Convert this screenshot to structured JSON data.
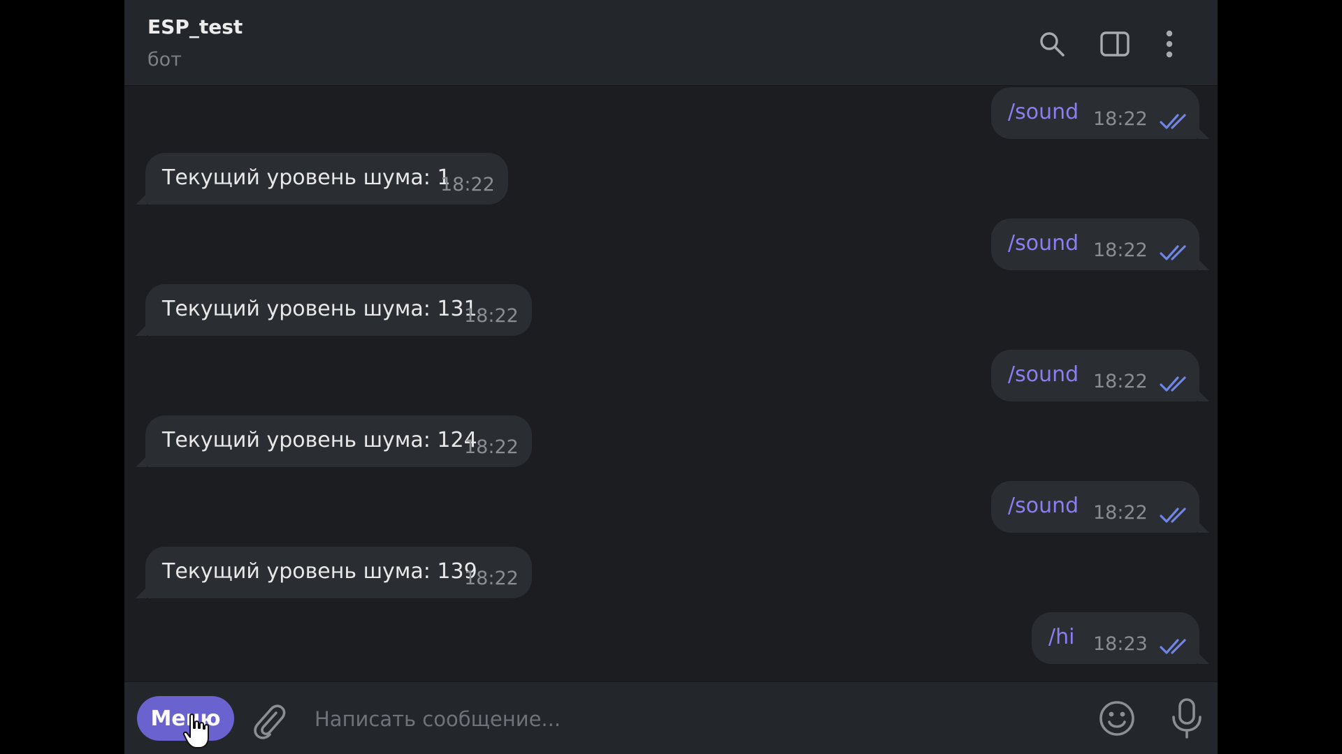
{
  "header": {
    "title": "ESP_test",
    "subtitle": "бот",
    "icons": [
      "search-icon",
      "side-panel-icon",
      "more-vertical-icon"
    ]
  },
  "messages": [
    {
      "direction": "out",
      "text": "/sound",
      "time": "18:22",
      "status": "read"
    },
    {
      "direction": "in",
      "text": "Текущий уровень шума: 1",
      "time": "18:22"
    },
    {
      "direction": "out",
      "text": "/sound",
      "time": "18:22",
      "status": "read"
    },
    {
      "direction": "in",
      "text": "Текущий уровень шума: 131",
      "time": "18:22"
    },
    {
      "direction": "out",
      "text": "/sound",
      "time": "18:22",
      "status": "read"
    },
    {
      "direction": "in",
      "text": "Текущий уровень шума: 124",
      "time": "18:22"
    },
    {
      "direction": "out",
      "text": "/sound",
      "time": "18:22",
      "status": "read"
    },
    {
      "direction": "in",
      "text": "Текущий уровень шума: 139",
      "time": "18:22"
    },
    {
      "direction": "out",
      "text": "/hi",
      "time": "18:23",
      "status": "read"
    }
  ],
  "composer": {
    "menu_label": "Меню",
    "placeholder": "Написать сообщение...",
    "value": "",
    "icons": [
      "paperclip-icon",
      "emoji-icon",
      "microphone-icon"
    ]
  },
  "colors": {
    "background": "#1b1d21",
    "bar": "#23272c",
    "bubble": "#2a2d31",
    "command_text": "#8a7ff0",
    "menu_button": "#6a62ce",
    "read_ticks": "#6f86e6"
  }
}
